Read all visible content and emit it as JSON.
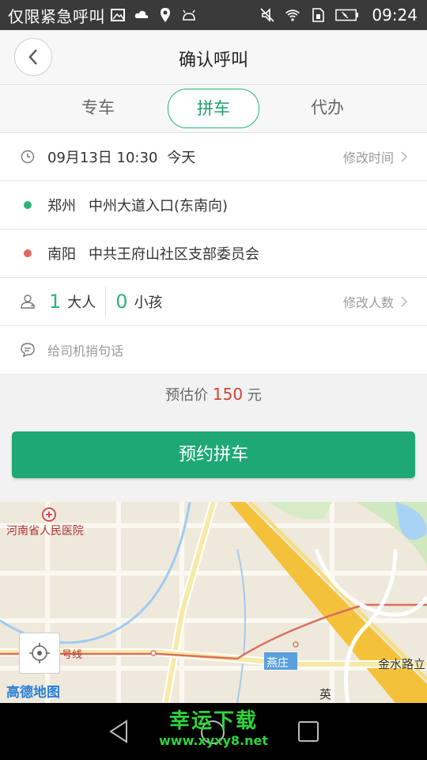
{
  "statusbar": {
    "carrier": "仅限紧急呼叫",
    "time": "09:24",
    "icons": [
      "image-icon",
      "cloud-icon",
      "location-icon",
      "android-icon",
      "mute-icon",
      "wifi-icon",
      "sim-icon",
      "battery-icon"
    ]
  },
  "header": {
    "title": "确认呼叫"
  },
  "tabs": [
    {
      "label": "专车"
    },
    {
      "label": "拼车"
    },
    {
      "label": "代办"
    }
  ],
  "trip": {
    "datetime": "09月13日 10:30",
    "day": "今天",
    "change_time": "修改时间",
    "origin_city": "郑州",
    "origin_place": "中州大道入口(东南向)",
    "origin_color": "#2bb37a",
    "dest_city": "南阳",
    "dest_place": "中共王府山社区支部委员会",
    "dest_color": "#e06a5c",
    "adults": "1",
    "adults_label": "大人",
    "children": "0",
    "children_label": "小孩",
    "change_people": "修改人数",
    "message_placeholder": "给司机捎句话"
  },
  "price": {
    "prefix": "预估价",
    "amount": "150",
    "unit": "元"
  },
  "action": {
    "book_label": "预约拼车"
  },
  "map": {
    "hospital": "河南省人民医院",
    "line": "号线",
    "station": "燕庄",
    "road": "金水路立",
    "char": "英",
    "logo": "高德地图"
  },
  "watermark": {
    "line1": "幸运下载",
    "line2": "www.xyxy8.net"
  },
  "colors": {
    "accent": "#1ea876",
    "price": "#d0442f"
  }
}
